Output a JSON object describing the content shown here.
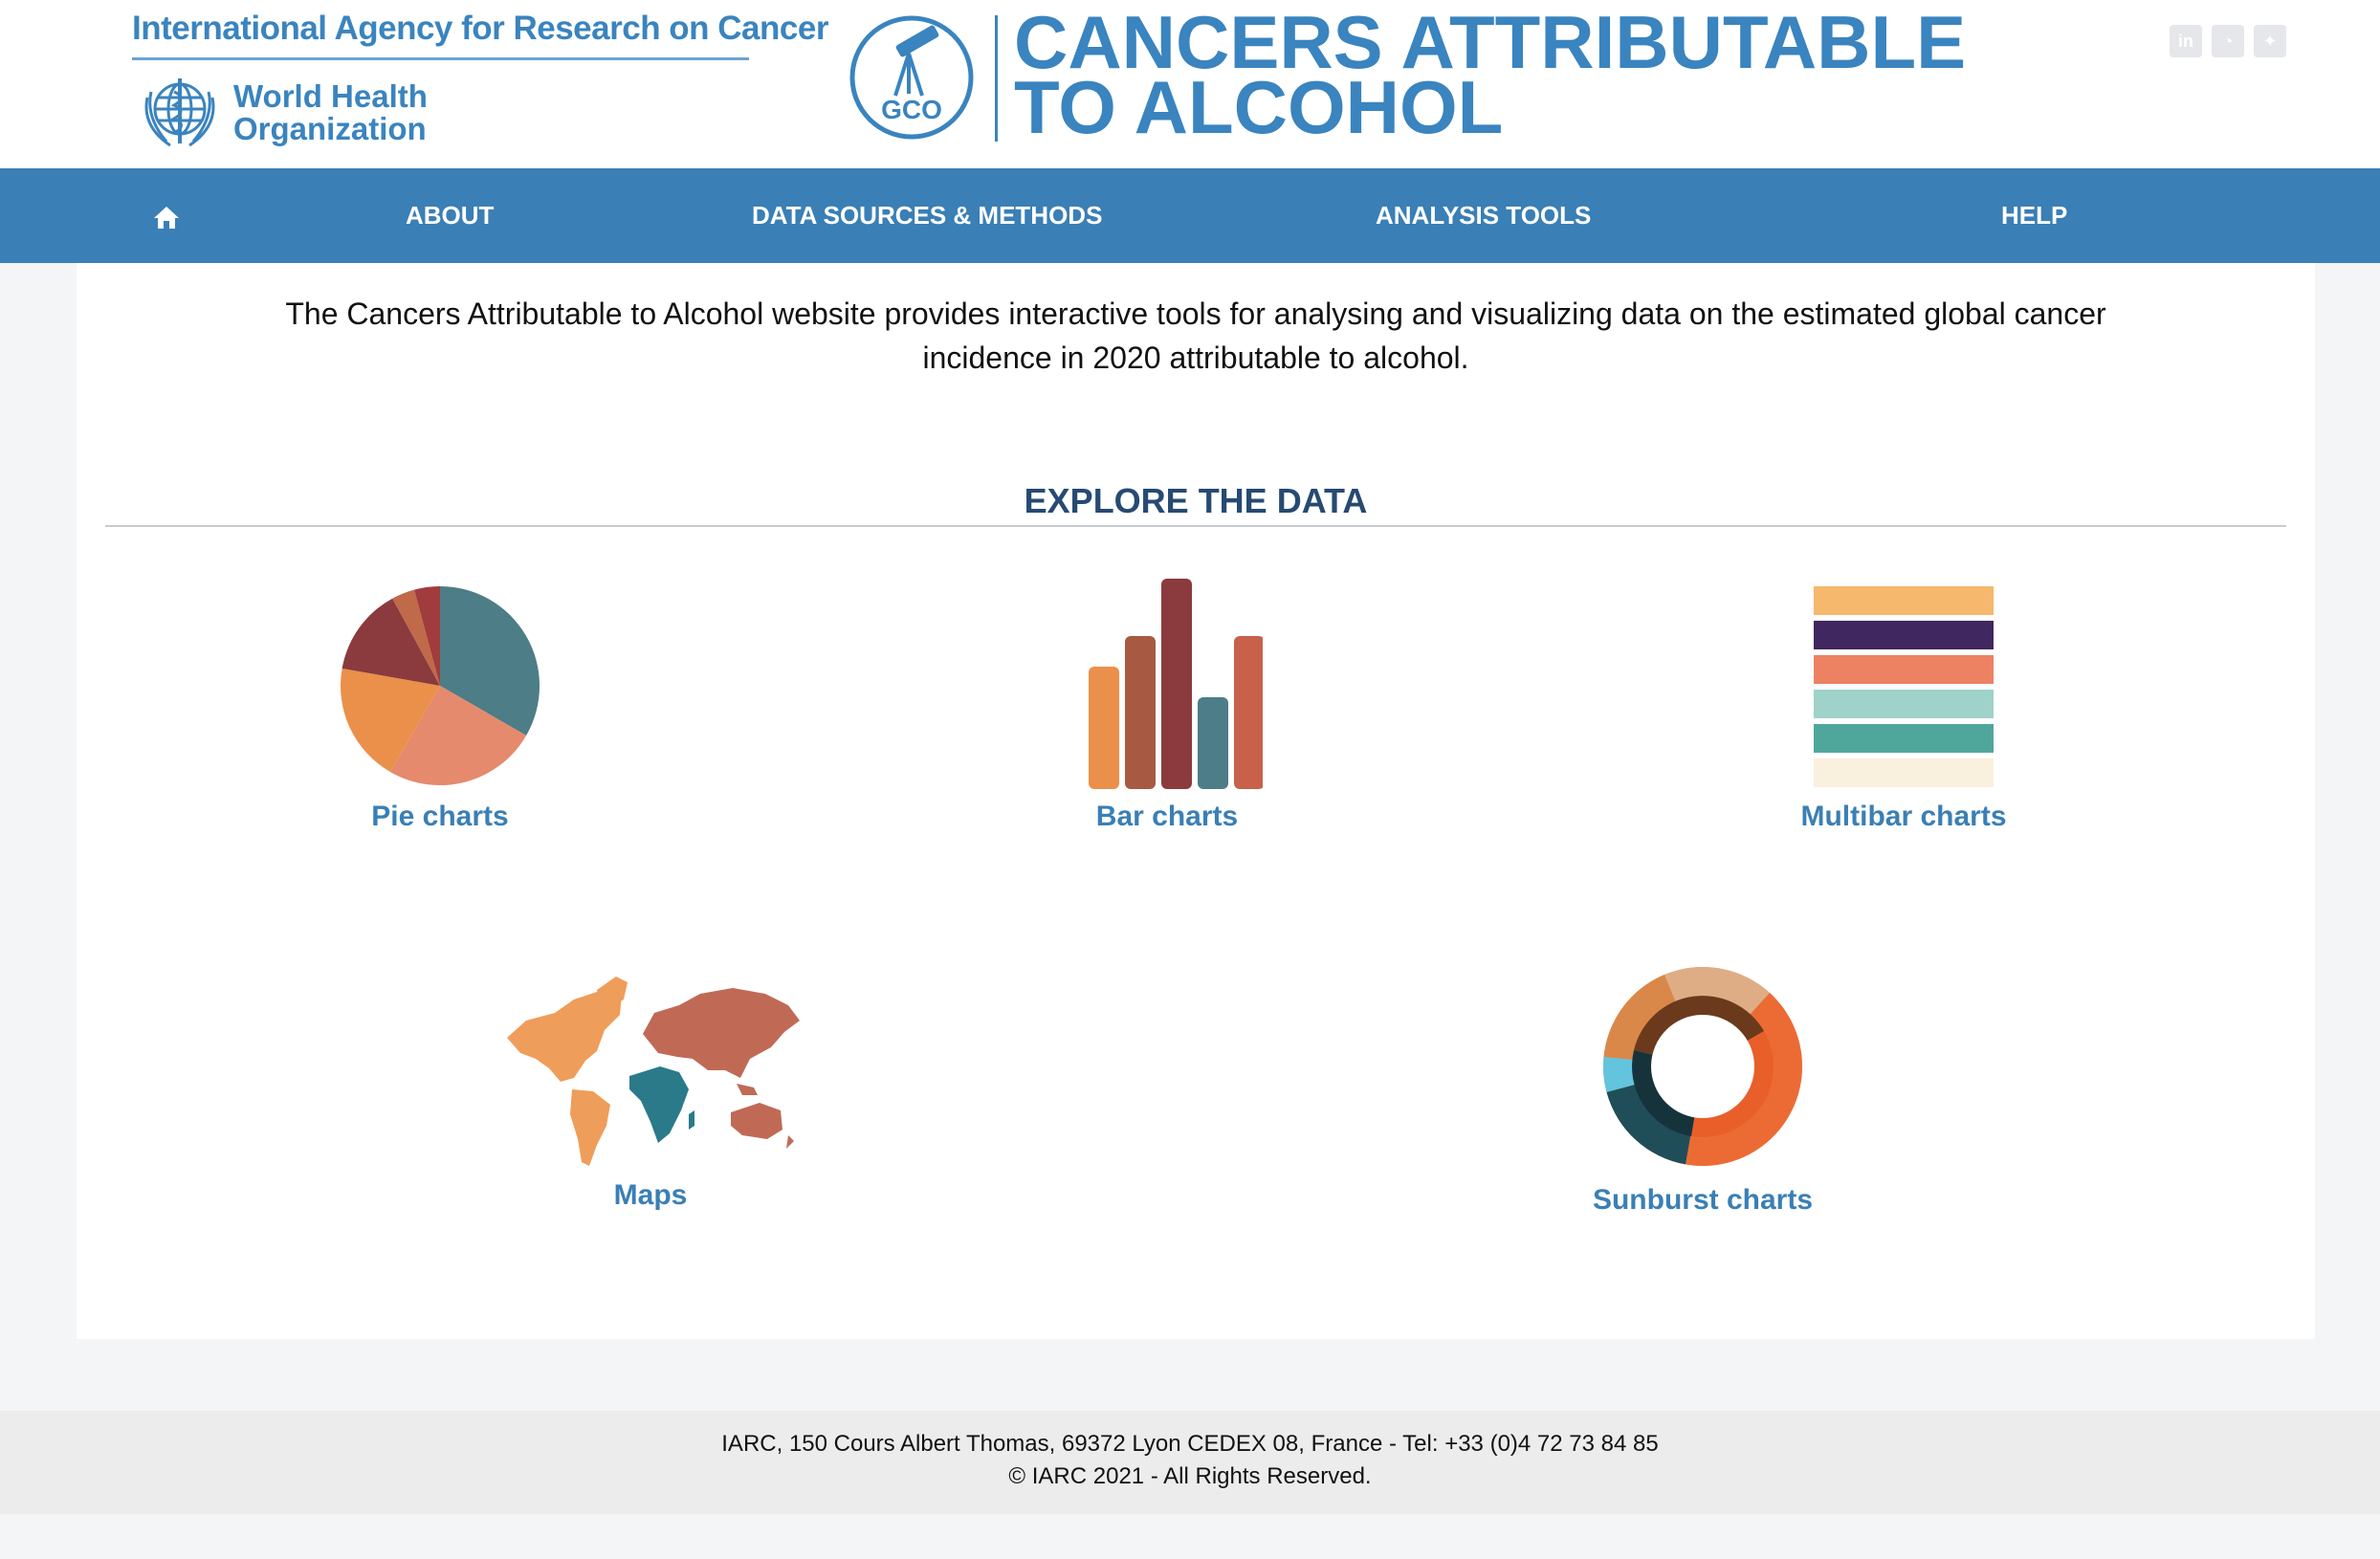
{
  "header": {
    "agency": "International Agency for Research on Cancer",
    "who_line1": "World Health",
    "who_line2": "Organization",
    "gco_label": "GCO",
    "title_line1": "CANCERS ATTRIBUTABLE",
    "title_line2": "TO ALCOHOL",
    "social": [
      {
        "icon": "linkedin-icon",
        "glyph": "in"
      },
      {
        "icon": "rss-icon",
        "glyph": "◔"
      },
      {
        "icon": "twitter-icon",
        "glyph": "✦"
      }
    ]
  },
  "nav": {
    "home_icon": "home-icon",
    "items": [
      "ABOUT",
      "DATA SOURCES & METHODS",
      "ANALYSIS TOOLS",
      "HELP"
    ]
  },
  "main": {
    "intro": "The Cancers Attributable to Alcohol website provides interactive tools for analysing and visualizing data on the estimated global cancer incidence in 2020 attributable to alcohol.",
    "explore_title": "EXPLORE THE DATA",
    "tools": [
      {
        "label": "Pie charts",
        "icon": "pie-chart-icon"
      },
      {
        "label": "Bar charts",
        "icon": "bar-chart-icon"
      },
      {
        "label": "Multibar charts",
        "icon": "multibar-chart-icon"
      },
      {
        "label": "Maps",
        "icon": "world-map-icon"
      },
      {
        "label": "Sunburst charts",
        "icon": "sunburst-chart-icon"
      }
    ]
  },
  "footer": {
    "address": "IARC, 150 Cours Albert Thomas, 69372 Lyon CEDEX 08, France - Tel: +33 (0)4 72 73 84 85",
    "copyright": "© IARC 2021 - All Rights Reserved."
  },
  "colors": {
    "brand_blue": "#3a84bf",
    "nav_blue": "#3a7fb5",
    "heading_navy": "#264a72",
    "link_blue": "#3a7fb5"
  }
}
